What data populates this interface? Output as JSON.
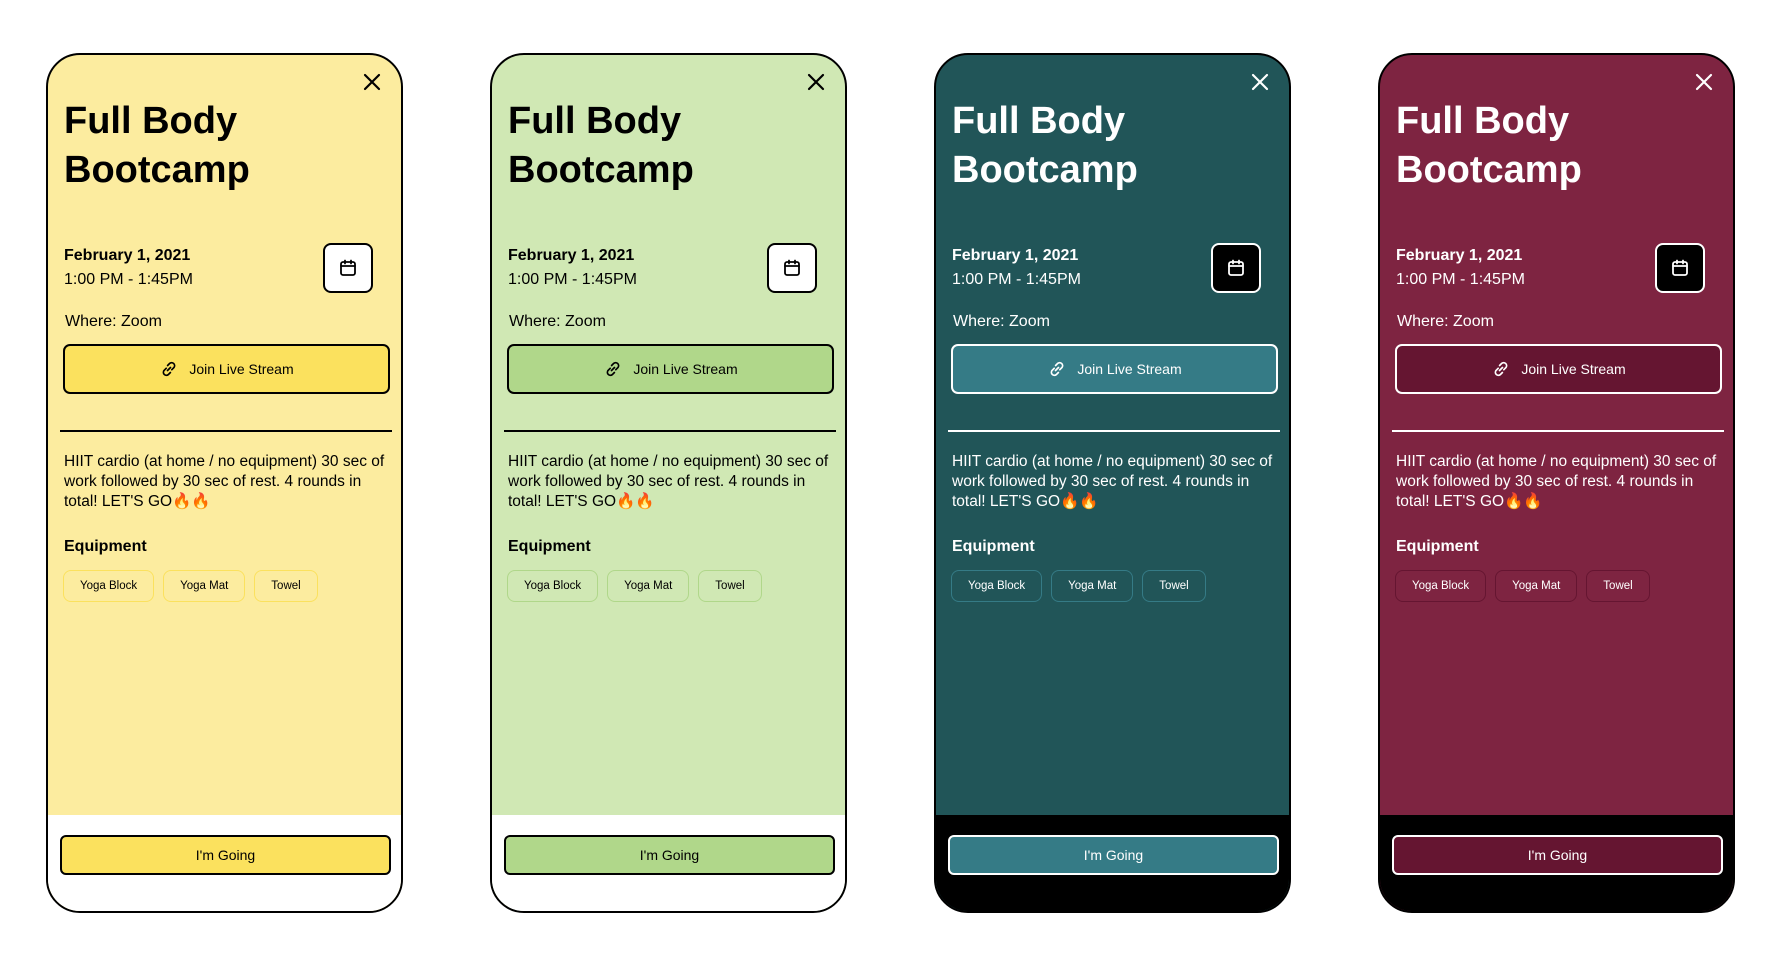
{
  "event": {
    "title": "Full Body Bootcamp",
    "date": "February 1, 2021",
    "time": "1:00 PM - 1:45PM",
    "where": "Where: Zoom",
    "join_label": "Join Live Stream",
    "description": "HIIT cardio (at home / no equipment) 30 sec of work followed by 30 sec of rest. 4 rounds in total! LET'S GO🔥🔥",
    "equipment_heading": "Equipment",
    "equipment": [
      "Yoga Block",
      "Yoga Mat",
      "Towel"
    ],
    "going_label": "I'm Going"
  },
  "themes": [
    {
      "name": "yellow",
      "background": "#fcec9f",
      "accent": "#fbe15e",
      "text": "#000000"
    },
    {
      "name": "green",
      "background": "#d0e8b4",
      "accent": "#b0d78a",
      "text": "#000000"
    },
    {
      "name": "teal",
      "background": "#215558",
      "accent": "#357b86",
      "text": "#ffffff"
    },
    {
      "name": "maroon",
      "background": "#7e2441",
      "accent": "#651531",
      "text": "#ffffff"
    }
  ],
  "icons": {
    "close": "close-icon",
    "calendar": "calendar-icon",
    "link": "link-icon"
  }
}
